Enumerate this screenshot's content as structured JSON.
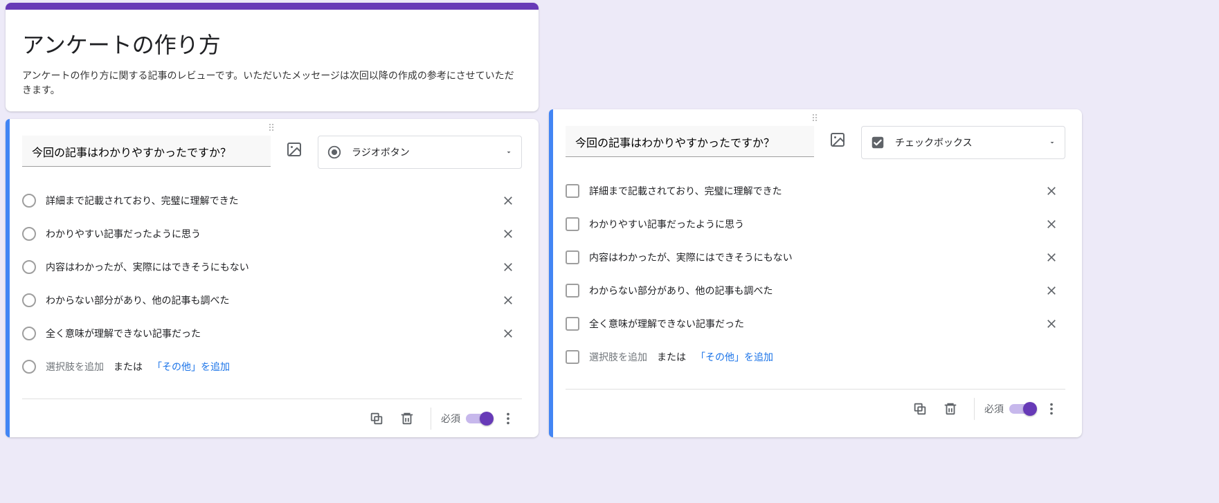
{
  "header": {
    "title": "アンケートの作り方",
    "description": "アンケートの作り方に関する記事のレビューです。いただいたメッセージは次回以降の作成の参考にさせていただきます。"
  },
  "question_left": {
    "title": "今回の記事はわかりやすかったですか？",
    "type_label": "ラジオボタン",
    "options": [
      "詳細まで記載されており、完璧に理解できた",
      "わかりやすい記事だったように思う",
      "内容はわかったが、実際にはできそうにもない",
      "わからない部分があり、他の記事も調べた",
      "全く意味が理解できない記事だった"
    ],
    "add_placeholder": "選択肢を追加",
    "add_or": "または",
    "add_other": "「その他」を追加",
    "required_label": "必須"
  },
  "question_right": {
    "title": "今回の記事はわかりやすかったですか？",
    "type_label": "チェックボックス",
    "options": [
      "詳細まで記載されており、完璧に理解できた",
      "わかりやすい記事だったように思う",
      "内容はわかったが、実際にはできそうにもない",
      "わからない部分があり、他の記事も調べた",
      "全く意味が理解できない記事だった"
    ],
    "add_placeholder": "選択肢を追加",
    "add_or": "または",
    "add_other": "「その他」を追加",
    "required_label": "必須"
  },
  "colors": {
    "accent": "#673ab7",
    "selected_blue": "#4285f4",
    "link_blue": "#1a73e8"
  }
}
